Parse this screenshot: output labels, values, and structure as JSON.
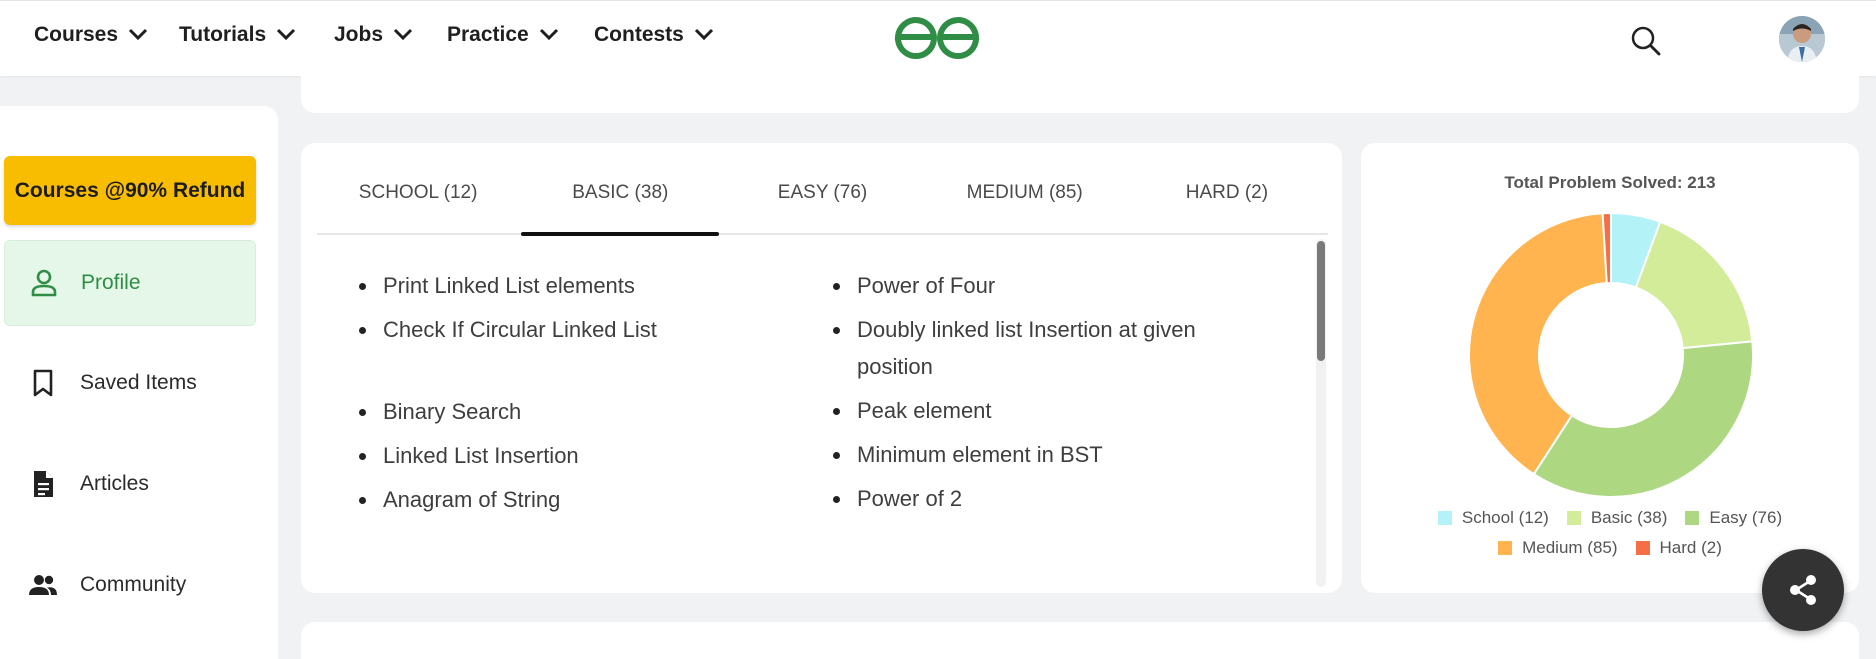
{
  "nav": {
    "items": [
      {
        "label": "Courses"
      },
      {
        "label": "Tutorials"
      },
      {
        "label": "Jobs"
      },
      {
        "label": "Practice"
      },
      {
        "label": "Contests"
      }
    ],
    "logo_icon": "gfg-logo",
    "search_icon": "search-icon",
    "brand_color": "#2f8d46"
  },
  "sidebar": {
    "promo_button": "Courses @90% Refund",
    "items": [
      {
        "label": "Profile",
        "icon": "person-icon",
        "active": true
      },
      {
        "label": "Saved Items",
        "icon": "bookmark-icon"
      },
      {
        "label": "Articles",
        "icon": "document-icon"
      },
      {
        "label": "Community",
        "icon": "people-icon"
      }
    ]
  },
  "problems": {
    "tabs": [
      {
        "label": "SCHOOL (12)"
      },
      {
        "label": "BASIC (38)",
        "active": true
      },
      {
        "label": "EASY (76)"
      },
      {
        "label": "MEDIUM (85)"
      },
      {
        "label": "HARD (2)"
      }
    ],
    "left_column": [
      "Print Linked List elements",
      "Check If Circular Linked List",
      "Binary Search",
      "Linked List Insertion",
      "Anagram of String"
    ],
    "right_column": [
      "Power of Four",
      "Doubly linked list Insertion at given position",
      "Peak element",
      "Minimum element in BST",
      "Power of 2"
    ]
  },
  "chart_data": {
    "type": "pie",
    "title": "Total Problem Solved: 213",
    "categories": [
      "School (12)",
      "Basic (38)",
      "Easy (76)",
      "Medium (85)",
      "Hard (2)"
    ],
    "values": [
      12,
      38,
      76,
      85,
      2
    ],
    "colors": [
      "#b3f2f7",
      "#d2ec9a",
      "#add881",
      "#ffb44f",
      "#f46f45"
    ],
    "legend_position": "bottom"
  }
}
